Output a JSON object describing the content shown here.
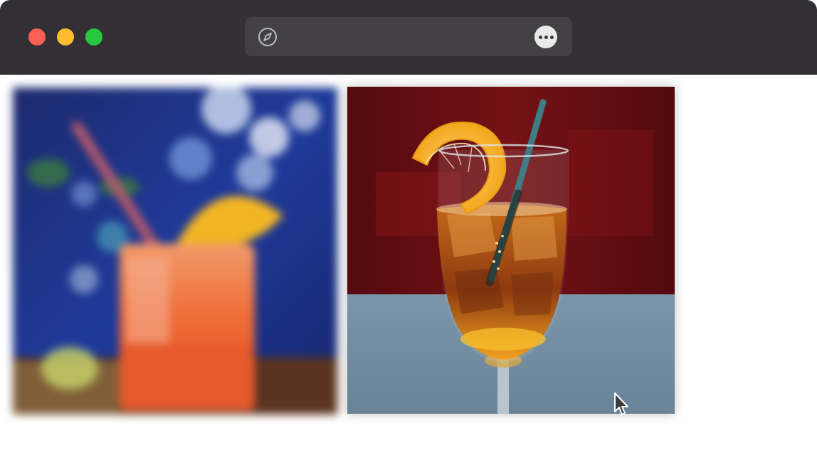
{
  "window": {
    "title": "",
    "colors": {
      "titlebar": "#323034",
      "close": "#fe5f57",
      "minimize": "#febc2e",
      "maximize": "#28c840"
    }
  },
  "toolbar": {
    "address_icon": "compass-icon",
    "url": "",
    "more_icon": "ellipsis-icon"
  },
  "gallery": {
    "images": [
      {
        "name": "blurred-mocktail-photo",
        "state": "blurred"
      },
      {
        "name": "cocktail-glass-photo",
        "state": "focused"
      }
    ]
  },
  "pointer": {
    "icon": "arrow-cursor-icon"
  }
}
